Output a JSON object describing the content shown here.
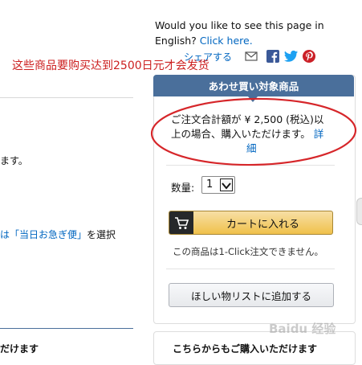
{
  "language_prompt": {
    "text": "Would you like to see this page in English?",
    "link": "Click here."
  },
  "share": {
    "label": "シェアする",
    "icons": [
      "mail-icon",
      "facebook-icon",
      "twitter-icon",
      "pinterest-icon"
    ]
  },
  "annotation": {
    "text": "这些商品要购买达到2500日元才会发货",
    "color": "#cc1f1f"
  },
  "left_fragment": {
    "text1": "ます。",
    "text2_quote": "は「当日お急ぎ便」",
    "text2_suffix": "を選択",
    "heading": "だけます"
  },
  "addon_box": {
    "header": "あわせ買い対象商品",
    "message_line1": "ご注文合計額が ¥ 2,500 (税込)以",
    "message_line2": "上の場合、購入いただけます。",
    "details_link_a": "詳",
    "details_link_b": "細",
    "quantity_label": "数量:",
    "quantity_value": "1",
    "add_to_cart": "カートに入れる",
    "one_click_note": "この商品は1-Click注文できません。",
    "wishlist": "ほしい物リストに追加する"
  },
  "other_purchase": {
    "title": "こちらからもご購入いただけます"
  },
  "watermark": "Baidu 经验",
  "colors": {
    "header_blue": "#4a6f9b",
    "link_blue": "#0066c0",
    "cart_yellow": "#f0c14b",
    "annotation_red": "#cc1f1f"
  }
}
